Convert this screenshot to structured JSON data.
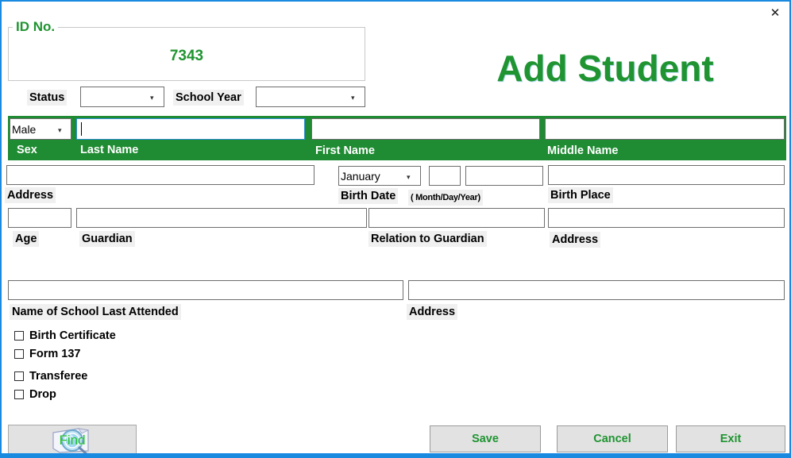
{
  "window": {
    "close_label": "✕",
    "accent_color": "#1a8ae0",
    "brand_green": "#1f9431",
    "band_green": "#1f8b32"
  },
  "header": {
    "title": "Add Student"
  },
  "id_group": {
    "legend": "ID No.",
    "value": "7343"
  },
  "status_row": {
    "status_label": "Status",
    "status_value": "",
    "school_year_label": "School Year",
    "school_year_value": ""
  },
  "name_band": {
    "sex_label": "Sex",
    "sex_value": "Male",
    "last_name_label": "Last Name",
    "last_name_value": "",
    "first_name_label": "First Name",
    "first_name_value": "",
    "middle_name_label": "Middle Name",
    "middle_name_value": ""
  },
  "row_address": {
    "address_label": "Address",
    "address_value": "",
    "birth_date_label": "Birth Date",
    "birth_date_hint": "( Month/Day/Year)",
    "birth_month_value": "January",
    "birth_day_value": "",
    "birth_year_value": "",
    "birth_place_label": "Birth Place",
    "birth_place_value": ""
  },
  "row_guardian": {
    "age_label": "Age",
    "age_value": "",
    "guardian_label": "Guardian",
    "guardian_value": "",
    "relation_label": "Relation to Guardian",
    "relation_value": "",
    "guardian_address_label": "Address",
    "guardian_address_value": ""
  },
  "row_school": {
    "last_school_label": "Name of School Last Attended",
    "last_school_value": "",
    "school_address_label": "Address",
    "school_address_value": ""
  },
  "checkboxes": [
    {
      "label": "Birth Certificate",
      "checked": false
    },
    {
      "label": "Form 137",
      "checked": false
    },
    {
      "label": "Transferee",
      "checked": false
    },
    {
      "label": "Drop",
      "checked": false
    }
  ],
  "buttons": {
    "find": "Find",
    "save": "Save",
    "cancel": "Cancel",
    "exit": "Exit"
  }
}
